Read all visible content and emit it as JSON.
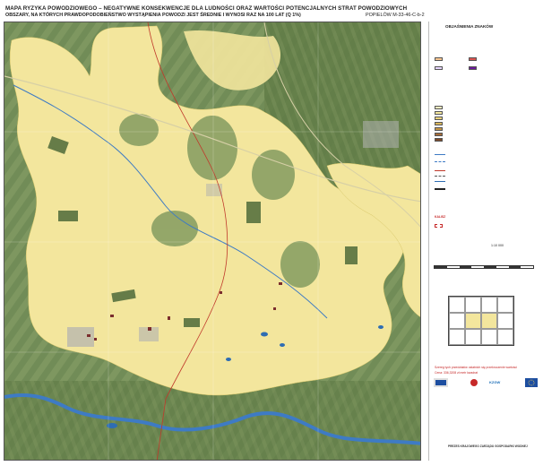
{
  "header": {
    "title_line1": "MAPA RYZYKA POWODZIOWEGO – NEGATYWNE KONSEKWENCJE DLA LUDNOŚCI ORAZ WARTOŚCI POTENCJALNYCH STRAT POWODZIOWYCH",
    "title_line2": "OBSZARY, NA KTÓRYCH PRAWDOPODOBIEŃSTWO WYSTĄPIENIA POWODZI JEST ŚREDNIE I WYNOSI RAZ NA 100 LAT (Q 1%)",
    "sheet": "POPIELÓW M-33-46-C-b-2"
  },
  "legend": {
    "title": "OBJAŚNIENIA ZNAKÓW",
    "stamp": "KALISZ"
  },
  "scale": {
    "label": "1:10 000"
  },
  "notes": {
    "red_line1": "Szereg tych przedziałów ostatnich się przekroczenie wartości",
    "red_line2": "Cena: 336,3208 zł metr kwadrat"
  },
  "logos": {
    "kzgw": "KZGW"
  },
  "footer": {
    "title": "PREZES KRAJOWEGO ZARZĄDU GOSPODARKI WODNEJ"
  },
  "colors": {
    "flood_yellow": "#f3e69d",
    "river": "#3e7bc4",
    "boundary": "#c0392b",
    "red_note": "#c62828"
  }
}
